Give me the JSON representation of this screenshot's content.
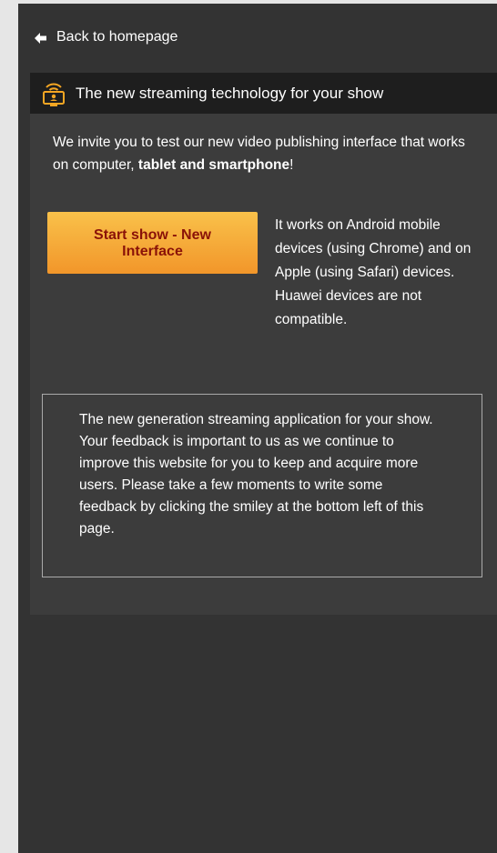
{
  "nav": {
    "back_label": "Back to homepage"
  },
  "panel": {
    "title": "The new streaming technology for your show",
    "intro_text": "We invite you to test our new video publishing interface that works on computer, ",
    "intro_bold": "tablet and smartphone",
    "intro_end": "!",
    "start_button_label": "Start show - New Interface",
    "compat_line1": "It works on Android mobile devices (using Chrome) and on Apple (using Safari) devices.",
    "compat_line2": "Huawei devices are not compatible.",
    "info_line1": "The new generation streaming application for your show.",
    "info_line2": "Your feedback is important to us as we continue to improve this website for you to keep and acquire more users. Please take a few moments to write some feedback by clicking the smiley at the bottom left of this page."
  },
  "colors": {
    "page_bg": "#333333",
    "panel_bg": "#3c3c3c",
    "header_bg": "#1e1e1e",
    "button_gradient_top": "#f9c14a",
    "button_gradient_bottom": "#f2962a",
    "button_text": "#8a1208",
    "icon_accent": "#f5a623"
  },
  "icons": {
    "back": "left-arrow-icon",
    "header": "streaming-monitor-icon"
  }
}
